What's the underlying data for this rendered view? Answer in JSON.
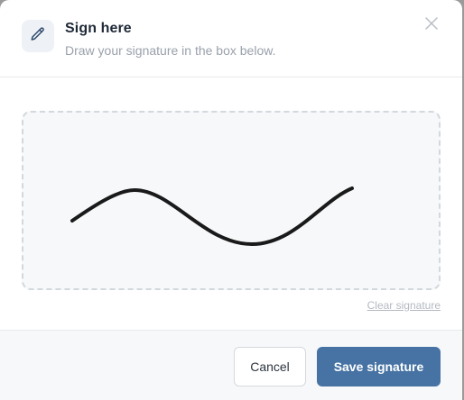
{
  "dialog": {
    "title": "Sign here",
    "subtitle": "Draw your signature in the box below.",
    "icon": "pencil-icon",
    "close_icon": "close-icon"
  },
  "signature_pad": {
    "clear_label": "Clear signature"
  },
  "footer": {
    "cancel_label": "Cancel",
    "save_label": "Save signature"
  },
  "colors": {
    "primary": "#4673a3",
    "stroke": "#1a1a1a",
    "pad_background": "#f6f8fa",
    "pad_border": "#d3d8dd"
  }
}
